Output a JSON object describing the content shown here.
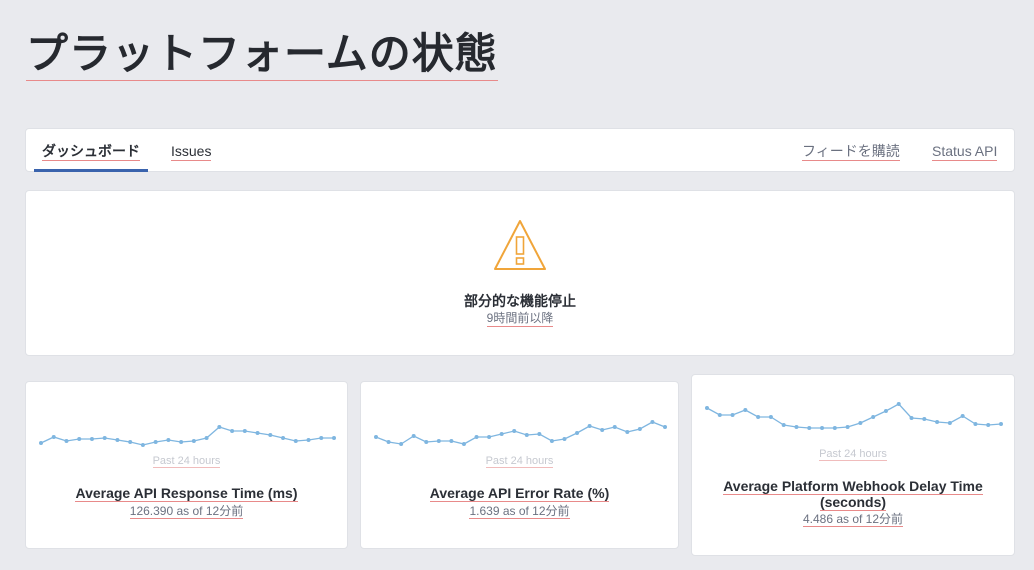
{
  "page": {
    "title": "プラットフォームの状態"
  },
  "nav": {
    "tabs": [
      {
        "label": "ダッシュボード",
        "active": true
      },
      {
        "label": "Issues",
        "active": false
      }
    ],
    "subscribe_label": "フィードを購読",
    "status_api_label": "Status API",
    "accent_color": "#3a63ad"
  },
  "status": {
    "icon": "warning-triangle-icon",
    "icon_color": "#f0a53a",
    "title": "部分的な機能停止",
    "subtitle": "9時間前以降"
  },
  "metrics": [
    {
      "title": "Average API Response Time (ms)",
      "period": "Past 24 hours",
      "value_text": "126.390 as of 12分前",
      "sparkline": [
        43,
        37,
        41,
        39,
        39,
        38,
        40,
        42,
        45,
        42,
        40,
        42,
        41,
        38,
        27,
        31,
        31,
        33,
        35,
        38,
        41,
        40,
        38,
        38
      ]
    },
    {
      "title": "Average API Error Rate (%)",
      "period": "Past 24 hours",
      "value_text": "1.639 as of 12分前",
      "sparkline": [
        37,
        42,
        44,
        36,
        42,
        41,
        41,
        44,
        37,
        37,
        34,
        31,
        35,
        34,
        41,
        39,
        33,
        26,
        30,
        27,
        32,
        29,
        22,
        27
      ]
    },
    {
      "title": "Average Platform Webhook Delay Time (seconds)",
      "period": "Past 24 hours",
      "value_text": "4.486 as of 12分前",
      "sparkline": [
        15,
        22,
        22,
        17,
        24,
        24,
        32,
        34,
        35,
        35,
        35,
        34,
        30,
        24,
        18,
        11,
        25,
        26,
        29,
        30,
        23,
        31,
        32,
        31
      ]
    }
  ],
  "colors": {
    "sparkline": "#7fb6e0",
    "underline": "#e88a8a",
    "background": "#e9eaee"
  }
}
